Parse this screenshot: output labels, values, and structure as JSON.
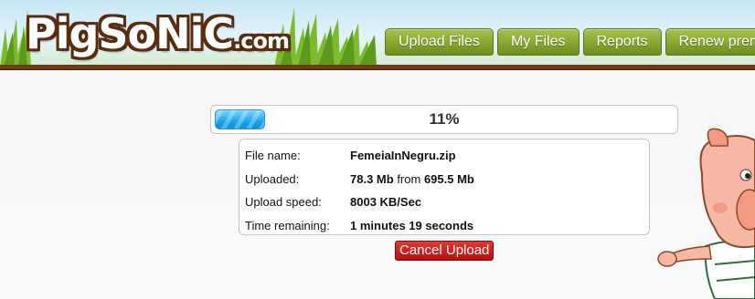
{
  "logo": {
    "text_big": "PigSoNiC",
    "text_small": ".com"
  },
  "nav": {
    "items": [
      "Upload Files",
      "My Files",
      "Reports",
      "Renew premium"
    ]
  },
  "progress": {
    "percent_label": "11%",
    "fraction": 0.11
  },
  "file_info": {
    "file_name_label": "File name:",
    "file_name_value": "FemeiaInNegru.zip",
    "uploaded_label": "Uploaded:",
    "uploaded_done": "78.3 Mb",
    "uploaded_from": "from",
    "uploaded_total": "695.5 Mb",
    "speed_label": "Upload speed:",
    "speed_value": "8003 KB/Sec",
    "remaining_label": "Time remaining:",
    "remaining_value": "1 minutes 19 seconds"
  },
  "actions": {
    "cancel_label": "Cancel Upload"
  },
  "colors": {
    "header_band": "#6e3b17",
    "nav_green": "#8aa832",
    "progress_blue": "#1aa3ee",
    "cancel_red": "#c4120f"
  }
}
